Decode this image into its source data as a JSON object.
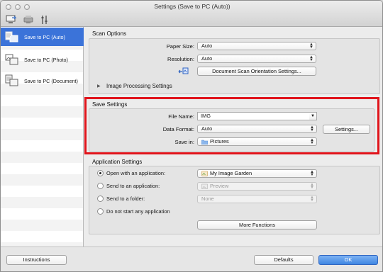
{
  "window": {
    "title": "Settings (Save to PC (Auto))"
  },
  "toolbar": [
    {
      "name": "scan-from-computer-tab-icon"
    },
    {
      "name": "scan-from-operation-panel-tab-icon"
    },
    {
      "name": "general-settings-tab-icon"
    }
  ],
  "sidebar": {
    "items": [
      {
        "label": "Save to PC (Auto)",
        "selected": true
      },
      {
        "label": "Save to PC (Photo)",
        "selected": false
      },
      {
        "label": "Save to PC (Document)",
        "selected": false
      }
    ]
  },
  "scan_options": {
    "title": "Scan Options",
    "paper_size_label": "Paper Size:",
    "paper_size_value": "Auto",
    "resolution_label": "Resolution:",
    "resolution_value": "Auto",
    "orientation_button": "Document Scan Orientation Settings...",
    "image_processing_label": "Image Processing Settings"
  },
  "save_settings": {
    "title": "Save Settings",
    "file_name_label": "File Name:",
    "file_name_value": "IMG",
    "data_format_label": "Data Format:",
    "data_format_value": "Auto",
    "settings_button": "Settings...",
    "save_in_label": "Save in:",
    "save_in_value": "Pictures"
  },
  "application_settings": {
    "title": "Application Settings",
    "open_with_label": "Open with an application:",
    "open_with_value": "My Image Garden",
    "send_to_app_label": "Send to an application:",
    "send_to_app_value": "Preview",
    "send_to_folder_label": "Send to a folder:",
    "send_to_folder_value": "None",
    "do_not_start_label": "Do not start any application",
    "more_functions_button": "More Functions"
  },
  "footer": {
    "instructions_button": "Instructions",
    "defaults_button": "Defaults",
    "ok_button": "OK"
  },
  "colors": {
    "highlight": "#e0141b",
    "selection": "#3b73d9",
    "primary_button": "#3f86e2"
  }
}
